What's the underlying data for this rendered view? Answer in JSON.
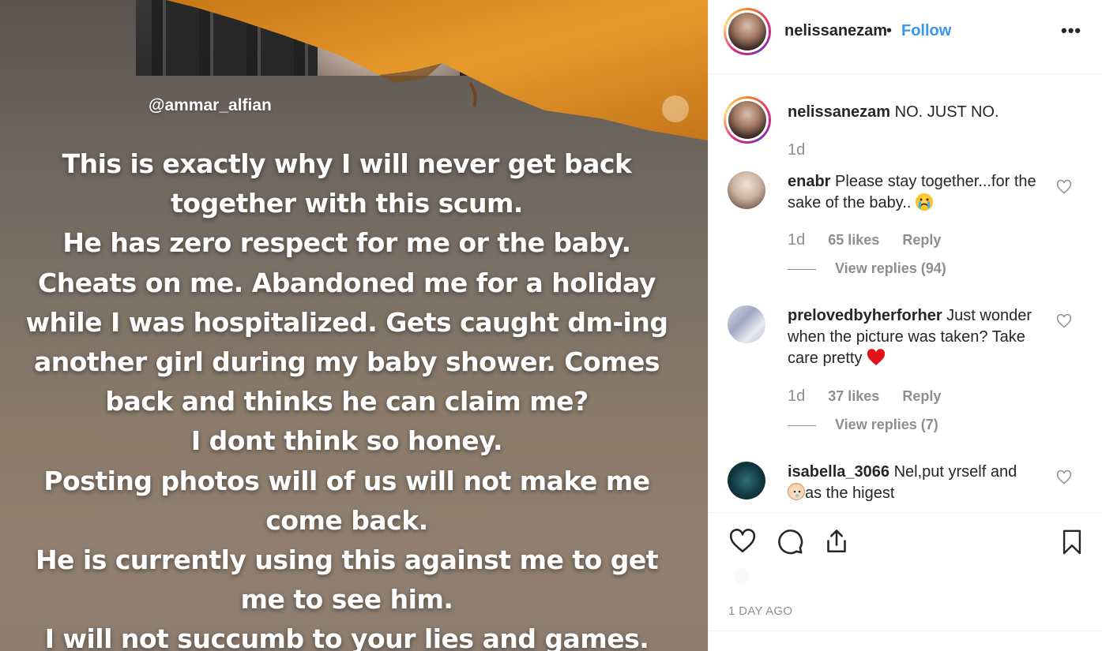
{
  "story": {
    "tag": "@ammar_alfian",
    "lines": [
      "This is exactly why I will never get back",
      "together with this scum.",
      "He has zero respect for me or the baby.",
      "Cheats on me. Abandoned me for a holiday",
      "while I was hospitalized. Gets caught dm-ing",
      "another girl during my baby shower. Comes",
      "back and thinks he can claim me?",
      "I dont think so honey.",
      "Posting photos will of us will not make me",
      "come back.",
      "He is currently using this against me to get",
      "me to see him.",
      "I will not succumb to your lies and games."
    ]
  },
  "header": {
    "username": "nelissanezam",
    "separator": "•",
    "follow_label": "Follow",
    "more_label": "•••"
  },
  "caption": {
    "username": "nelissanezam",
    "text": "NO. JUST NO.",
    "time": "1d"
  },
  "comments": [
    {
      "username": "enabr",
      "text": "Please stay together...for the sake of the baby..",
      "emoji": "crying-face-emoji",
      "time": "1d",
      "likes": "65 likes",
      "reply_label": "Reply",
      "view_replies": "View replies (94)"
    },
    {
      "username": "prelovedbyherforher",
      "text": "Just wonder when the picture was taken? Take care pretty",
      "emoji": "red-heart-emoji",
      "time": "1d",
      "likes": "37 likes",
      "reply_label": "Reply",
      "view_replies": "View replies (7)"
    },
    {
      "username": "isabella_3066",
      "text_before": "Nel,put yrself and",
      "emoji": "baby-face-emoji",
      "text_after": "as the higest"
    }
  ],
  "footer": {
    "time_ago": "1 DAY AGO"
  },
  "icons": [
    "heart-icon",
    "comment-icon",
    "share-icon",
    "bookmark-icon",
    "more-icon"
  ],
  "colors": {
    "link_blue": "#3897f0",
    "muted_gray": "#8e8e8e",
    "text_dark": "#262626",
    "border": "#efefef"
  }
}
